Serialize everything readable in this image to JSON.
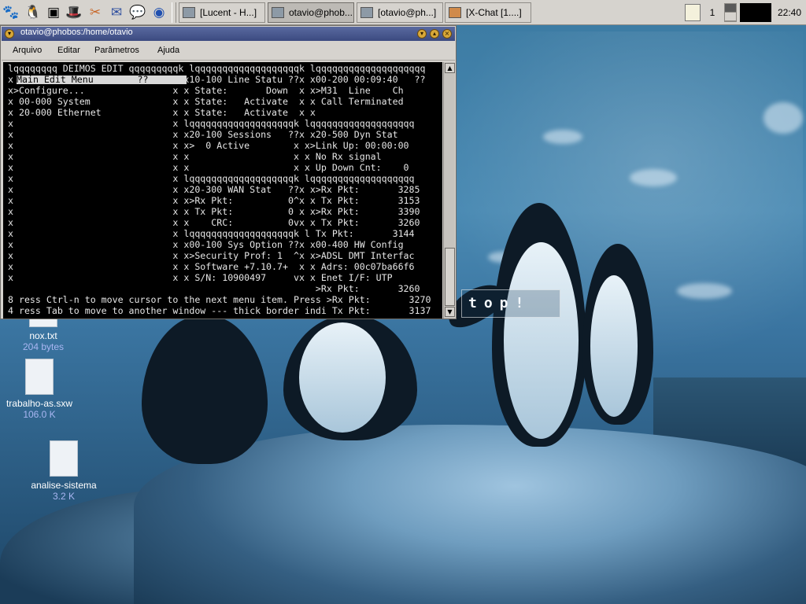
{
  "panel": {
    "launchers": [
      {
        "icon": "gnome-foot-icon",
        "glyph": "🐾"
      },
      {
        "icon": "tux-icon",
        "glyph": "🐧"
      },
      {
        "icon": "terminal-launcher-icon",
        "glyph": "▣"
      },
      {
        "icon": "redhat-icon",
        "glyph": "🎩"
      },
      {
        "icon": "xchat-launcher-icon",
        "glyph": "✂"
      },
      {
        "icon": "mail-icon",
        "glyph": "✉"
      },
      {
        "icon": "chat-bubble-icon",
        "glyph": "💬"
      },
      {
        "icon": "browser-icon",
        "glyph": "◉"
      }
    ],
    "tasks": [
      {
        "label": "[Lucent - H...]",
        "active": false
      },
      {
        "label": "otavio@phob...",
        "active": true
      },
      {
        "label": "[otavio@ph...]",
        "active": false
      },
      {
        "label": "[X-Chat [1....]",
        "active": false
      }
    ],
    "desktop_number": "1",
    "clock": "22:40"
  },
  "terminal": {
    "title": "otavio@phobos:/home/otavio",
    "menu": [
      "Arquivo",
      "Editar",
      "Parâmetros",
      "Ajuda"
    ],
    "highlight_line": "Main Edit Menu        ??",
    "lines": [
      "lqqqqqqqq DEIMOS EDIT qqqqqqqqqk lqqqqqqqqqqqqqqqqqqqk lqqqqqqqqqqqqqqqqqqqq",
      "x                           ??x x10-100 Line Statu ??x x00-200 00:09:40   ??",
      "x>Configure...                x x State:       Down  x x>M31  Line    Ch",
      "x 00-000 System               x x State:   Activate  x x Call Terminated",
      "x 20-000 Ethernet             x x State:   Activate  x x",
      "x                             x lqqqqqqqqqqqqqqqqqqqk lqqqqqqqqqqqqqqqqqqq",
      "x                             x x20-100 Sessions   ??x x20-500 Dyn Stat",
      "x                             x x>  0 Active        x x>Link Up: 00:00:00",
      "x                             x x                   x x No Rx signal",
      "x                             x x                   x x Up Down Cnt:    0",
      "x                             x lqqqqqqqqqqqqqqqqqqqk lqqqqqqqqqqqqqqqqqqq",
      "x                             x x20-300 WAN Stat   ??x x>Rx Pkt:       3285",
      "x                             x x>Rx Pkt:          0^x x Tx Pkt:       3153",
      "x                             x x Tx Pkt:          0 x x>Rx Pkt:       3390",
      "x                             x x    CRC:          0vx x Tx Pkt:       3260",
      "x                             x lqqqqqqqqqqqqqqqqqqqk l Tx Pkt:       3144",
      "x                             x x00-100 Sys Option ??x x00-400 HW Config",
      "x                             x x>Security Prof: 1  ^x x>ADSL DMT Interfac",
      "x                             x x Software +7.10.7+  x x Adrs: 00c07ba66f6",
      "x                             x x S/N: 10900497     vx x Enet I/F: UTP",
      "                                                        >Rx Pkt:       3260",
      "8 ress Ctrl-n to move cursor to the next menu item. Press >Rx Pkt:       3270",
      "4 ress Tab to move to another window --- thick border indi Tx Pkt:       3137"
    ]
  },
  "desktop": {
    "overlay_text": "top!",
    "icons": [
      {
        "name": "nox.txt",
        "size": "204 bytes"
      },
      {
        "name": "trabalho-as.sxw",
        "size": "106.0 K"
      },
      {
        "name": "analise-sistema",
        "size": "3.2 K"
      }
    ]
  },
  "colors": {
    "panel_bg": "#d6d3ce",
    "titlebar": "#3b4a80",
    "terminal_bg": "#000000",
    "terminal_fg": "#e6e6e6",
    "icon_size_text": "#a9b6f2"
  }
}
